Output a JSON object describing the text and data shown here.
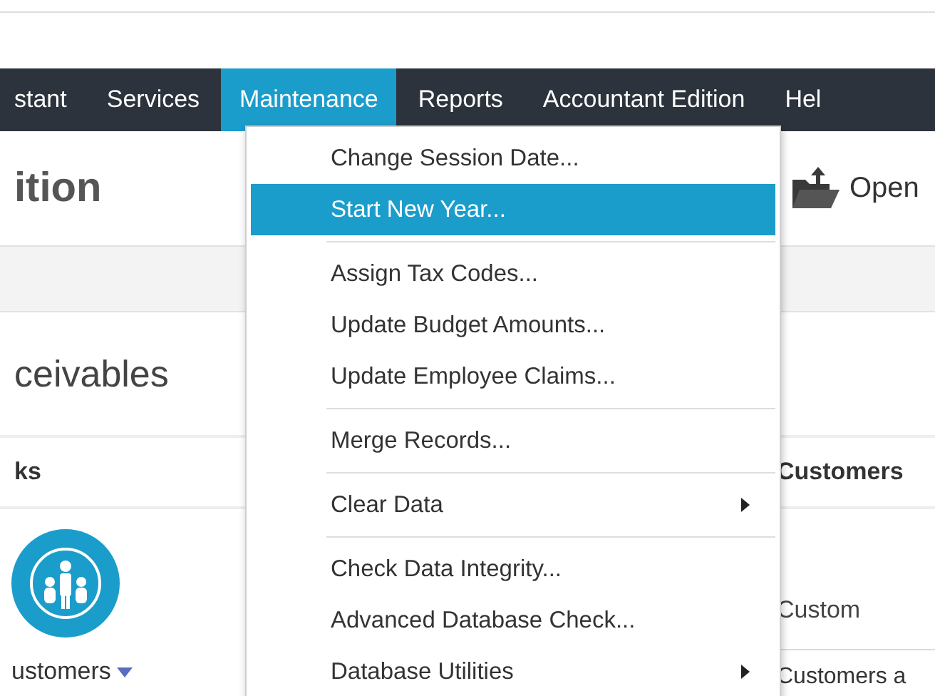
{
  "menu_bar": {
    "items": [
      {
        "label": "stant",
        "selected": false
      },
      {
        "label": "Services",
        "selected": false
      },
      {
        "label": "Maintenance",
        "selected": true
      },
      {
        "label": "Reports",
        "selected": false
      },
      {
        "label": "Accountant Edition",
        "selected": false
      },
      {
        "label": "Hel",
        "selected": false
      }
    ]
  },
  "header": {
    "title": "ition",
    "open_button": "Open"
  },
  "section_title": "ceivables",
  "left_panel": {
    "heading": "ks",
    "shortcut": "ustomers"
  },
  "right_panel": {
    "heading": "Customers",
    "column_1": "Custom",
    "row_1": "Customers a"
  },
  "dropdown": {
    "groups": [
      {
        "items": [
          {
            "label": "Change Session Date...",
            "selected": false,
            "has_submenu": false
          },
          {
            "label": "Start New Year...",
            "selected": true,
            "has_submenu": false
          }
        ]
      },
      {
        "items": [
          {
            "label": "Assign Tax Codes...",
            "selected": false,
            "has_submenu": false
          },
          {
            "label": "Update Budget Amounts...",
            "selected": false,
            "has_submenu": false
          },
          {
            "label": "Update Employee Claims...",
            "selected": false,
            "has_submenu": false
          }
        ]
      },
      {
        "items": [
          {
            "label": "Merge Records...",
            "selected": false,
            "has_submenu": false
          }
        ]
      },
      {
        "items": [
          {
            "label": "Clear Data",
            "selected": false,
            "has_submenu": true
          }
        ]
      },
      {
        "items": [
          {
            "label": "Check Data Integrity...",
            "selected": false,
            "has_submenu": false
          },
          {
            "label": "Advanced Database Check...",
            "selected": false,
            "has_submenu": false
          },
          {
            "label": "Database Utilities",
            "selected": false,
            "has_submenu": true
          }
        ]
      }
    ]
  }
}
